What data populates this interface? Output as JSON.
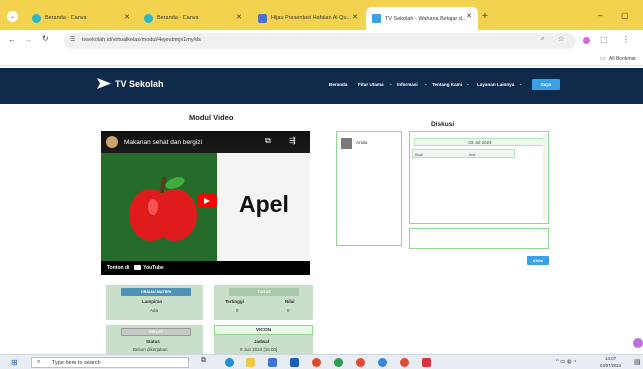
{
  "browser": {
    "tabs": [
      {
        "label": "Beranda - Canva",
        "active": false
      },
      {
        "label": "Beranda - Canva",
        "active": false
      },
      {
        "label": "Hijau Presentasi Hafalan Al Qu...",
        "active": false
      },
      {
        "label": "TV Sekolah - Wahana Belajar d...",
        "active": true
      }
    ],
    "new_tab": "+",
    "url": "tvsekolah.id/virtualkelas/modul/4ejeubmjx1my/ds",
    "bookmarks_label": "All Bookmar",
    "window_controls": {
      "minimize": "–",
      "maximize": "▢"
    }
  },
  "site": {
    "logo_text": "TV Sekolah",
    "menu": [
      "Beranda",
      "Fitur Utama",
      "Informasi",
      "Tentang Kami",
      "Layanan Lainnya"
    ],
    "login_label": "Saya"
  },
  "module": {
    "title": "Modul Video",
    "video": {
      "title": "Makanan sehat dan bergizi",
      "word": "Apel",
      "watch_on": "Tonton di",
      "youtube": "YouTube"
    }
  },
  "discussion": {
    "title": "Diskusi",
    "member": "Anda",
    "date": "03 Jul 2024",
    "msg_sender": "Budi",
    "msg_text": "test",
    "send_label": "Kirim"
  },
  "cards": {
    "materi": {
      "button": "URAIAN MATERI",
      "label": "Lampiran",
      "value": "Ada"
    },
    "nilai": {
      "button": "TUGAS",
      "label1": "Tertinggi",
      "label2": "Nilai",
      "value1": "0",
      "value2": "0"
    },
    "status": {
      "button": "DIKLAT",
      "label": "Status",
      "value": "Belum dikerjakan"
    },
    "vicon": {
      "button": "VICON",
      "label": "Jadwal",
      "value": "8 Jun 2024 [16:00]"
    }
  },
  "taskbar": {
    "search_placeholder": "Type here to search",
    "time": "14:07",
    "date": "03/07/2024"
  },
  "colors": {
    "tabstrip": "#f2d24e",
    "header": "#102a4c",
    "accent": "#3aa0e8",
    "card_green": "#c8dfc9",
    "card_button": "#4d93b8",
    "youtube_red": "#ff0000"
  }
}
